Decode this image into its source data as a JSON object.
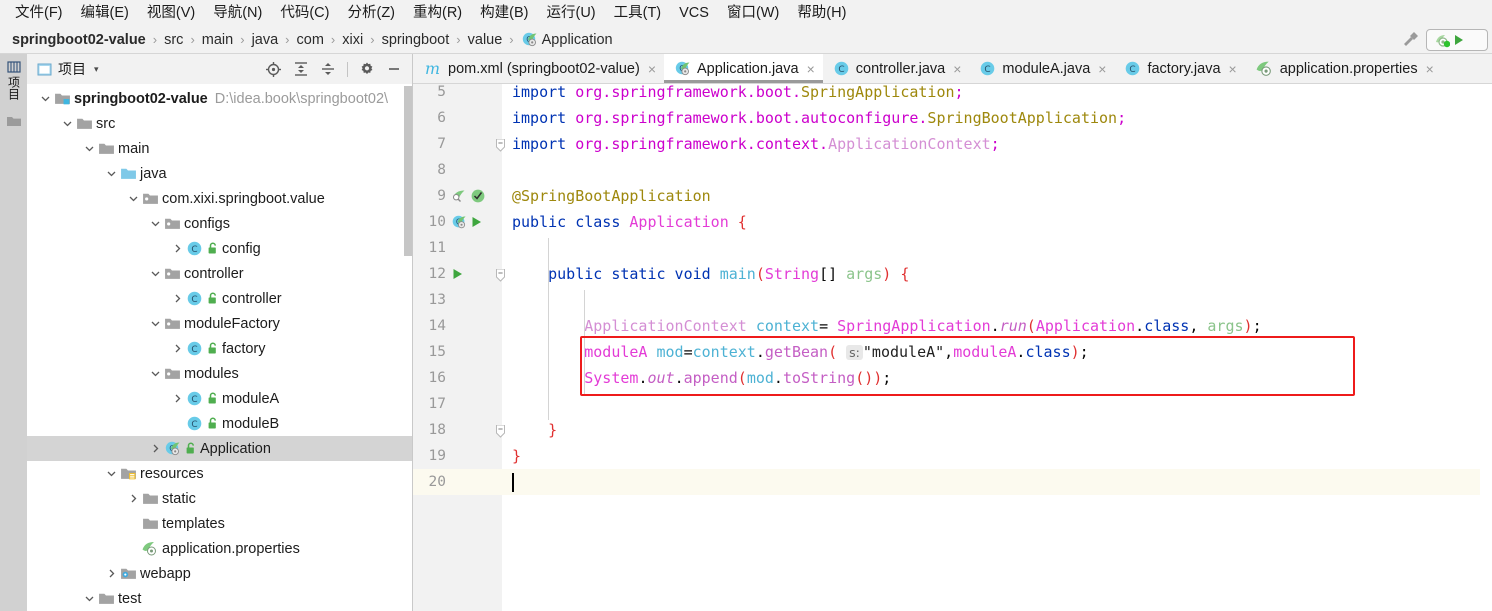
{
  "menubar": {
    "items": [
      {
        "label": "文件(F)"
      },
      {
        "label": "编辑(E)"
      },
      {
        "label": "视图(V)"
      },
      {
        "label": "导航(N)"
      },
      {
        "label": "代码(C)"
      },
      {
        "label": "分析(Z)"
      },
      {
        "label": "重构(R)"
      },
      {
        "label": "构建(B)"
      },
      {
        "label": "运行(U)"
      },
      {
        "label": "工具(T)"
      },
      {
        "label": "VCS"
      },
      {
        "label": "窗口(W)"
      },
      {
        "label": "帮助(H)"
      }
    ]
  },
  "breadcrumb": {
    "items": [
      {
        "label": "springboot02-value",
        "icon": "none"
      },
      {
        "label": "src",
        "icon": "none"
      },
      {
        "label": "main",
        "icon": "none"
      },
      {
        "label": "java",
        "icon": "none"
      },
      {
        "label": "com",
        "icon": "none"
      },
      {
        "label": "xixi",
        "icon": "none"
      },
      {
        "label": "springboot",
        "icon": "none"
      },
      {
        "label": "value",
        "icon": "none"
      },
      {
        "label": "Application",
        "icon": "spring-class-icon"
      }
    ],
    "separator": "›",
    "build_icon": "hammer-icon",
    "run_config_icon": "spring-run-config-icon"
  },
  "toolstrip": {
    "project_label": "项目",
    "folder_icon": "folder-icon"
  },
  "project_panel": {
    "title": "项目",
    "caret": "▾",
    "tools": [
      {
        "name": "locate-icon",
        "glyph": "target"
      },
      {
        "name": "expand-all-icon",
        "glyph": "expand"
      },
      {
        "name": "collapse-all-icon",
        "glyph": "collapse"
      },
      {
        "name": "settings-icon",
        "glyph": "gear"
      },
      {
        "name": "hide-icon",
        "glyph": "minus"
      }
    ],
    "tree": [
      {
        "label": "springboot02-value",
        "sub": "D:\\idea.book\\springboot02\\",
        "depth": 0,
        "twisty": "down",
        "icon": "module-folder-icon",
        "bold": true,
        "selected": false,
        "badge": ""
      },
      {
        "label": "src",
        "depth": 1,
        "twisty": "down",
        "icon": "folder-icon",
        "bold": false,
        "selected": false,
        "badge": ""
      },
      {
        "label": "main",
        "depth": 2,
        "twisty": "down",
        "icon": "folder-icon",
        "bold": false,
        "selected": false,
        "badge": ""
      },
      {
        "label": "java",
        "depth": 3,
        "twisty": "down",
        "icon": "source-folder-icon",
        "bold": false,
        "selected": false,
        "badge": ""
      },
      {
        "label": "com.xixi.springboot.value",
        "depth": 4,
        "twisty": "down",
        "icon": "package-icon",
        "bold": false,
        "selected": false,
        "badge": ""
      },
      {
        "label": "configs",
        "depth": 5,
        "twisty": "down",
        "icon": "package-icon",
        "bold": false,
        "selected": false,
        "badge": ""
      },
      {
        "label": "config",
        "depth": 6,
        "twisty": "right",
        "icon": "java-class-icon",
        "bold": false,
        "selected": false,
        "badge": "green-lock-icon"
      },
      {
        "label": "controller",
        "depth": 5,
        "twisty": "down",
        "icon": "package-icon",
        "bold": false,
        "selected": false,
        "badge": ""
      },
      {
        "label": "controller",
        "depth": 6,
        "twisty": "right",
        "icon": "java-class-icon",
        "bold": false,
        "selected": false,
        "badge": "green-lock-icon"
      },
      {
        "label": "moduleFactory",
        "depth": 5,
        "twisty": "down",
        "icon": "package-icon",
        "bold": false,
        "selected": false,
        "badge": ""
      },
      {
        "label": "factory",
        "depth": 6,
        "twisty": "right",
        "icon": "java-class-icon",
        "bold": false,
        "selected": false,
        "badge": "green-lock-icon"
      },
      {
        "label": "modules",
        "depth": 5,
        "twisty": "down",
        "icon": "package-icon",
        "bold": false,
        "selected": false,
        "badge": ""
      },
      {
        "label": "moduleA",
        "depth": 6,
        "twisty": "right",
        "icon": "java-class-icon",
        "bold": false,
        "selected": false,
        "badge": "green-lock-icon"
      },
      {
        "label": "moduleB",
        "depth": 6,
        "twisty": "none",
        "icon": "java-class-icon",
        "bold": false,
        "selected": false,
        "badge": "green-lock-icon"
      },
      {
        "label": "Application",
        "depth": 5,
        "twisty": "right",
        "icon": "spring-class-icon",
        "bold": false,
        "selected": true,
        "badge": "green-lock-icon"
      },
      {
        "label": "resources",
        "depth": 3,
        "twisty": "down",
        "icon": "resource-folder-icon",
        "bold": false,
        "selected": false,
        "badge": ""
      },
      {
        "label": "static",
        "depth": 4,
        "twisty": "right",
        "icon": "folder-icon",
        "bold": false,
        "selected": false,
        "badge": ""
      },
      {
        "label": "templates",
        "depth": 4,
        "twisty": "none",
        "icon": "folder-icon",
        "bold": false,
        "selected": false,
        "badge": ""
      },
      {
        "label": "application.properties",
        "depth": 4,
        "twisty": "none",
        "icon": "spring-properties-icon",
        "bold": false,
        "selected": false,
        "badge": ""
      },
      {
        "label": "webapp",
        "depth": 3,
        "twisty": "right",
        "icon": "webapp-folder-icon",
        "bold": false,
        "selected": false,
        "badge": ""
      },
      {
        "label": "test",
        "depth": 2,
        "twisty": "down",
        "icon": "folder-icon",
        "bold": false,
        "selected": false,
        "badge": ""
      }
    ]
  },
  "tabs": [
    {
      "label": "pom.xml (springboot02-value)",
      "icon": "maven-icon",
      "active": false,
      "close": "×"
    },
    {
      "label": "Application.java",
      "icon": "spring-class-icon",
      "active": true,
      "close": "×"
    },
    {
      "label": "controller.java",
      "icon": "java-class-icon",
      "active": false,
      "close": "×"
    },
    {
      "label": "moduleA.java",
      "icon": "java-class-icon",
      "active": false,
      "close": "×"
    },
    {
      "label": "factory.java",
      "icon": "java-class-icon",
      "active": false,
      "close": "×"
    },
    {
      "label": "application.properties",
      "icon": "spring-properties-icon",
      "active": false,
      "close": "×"
    }
  ],
  "editor": {
    "first_visible_line": 5,
    "caret_line": 20,
    "lines": [
      {
        "num": 5,
        "text": "import org.springframework.boot.SpringApplication;"
      },
      {
        "num": 6,
        "text": "import org.springframework.boot.autoconfigure.SpringBootApplication;"
      },
      {
        "num": 7,
        "text": "import org.springframework.context.ApplicationContext;"
      },
      {
        "num": 8,
        "text": ""
      },
      {
        "num": 9,
        "text": "@SpringBootApplication"
      },
      {
        "num": 10,
        "text": "public class Application {"
      },
      {
        "num": 11,
        "text": ""
      },
      {
        "num": 12,
        "text": "    public static void main(String[] args) {"
      },
      {
        "num": 13,
        "text": ""
      },
      {
        "num": 14,
        "text": "        ApplicationContext context= SpringApplication.run(Application.class, args);"
      },
      {
        "num": 15,
        "text": "        moduleA mod=context.getBean( s: \"moduleA\",moduleA.class);"
      },
      {
        "num": 16,
        "text": "        System.out.append(mod.toString());"
      },
      {
        "num": 17,
        "text": ""
      },
      {
        "num": 18,
        "text": "    }"
      },
      {
        "num": 19,
        "text": "}"
      },
      {
        "num": 20,
        "text": ""
      }
    ],
    "inlay_hint": "s:",
    "gutter_icons": [
      {
        "line": 9,
        "icons": [
          "spring-bean-icon",
          "spring-config-icon"
        ]
      },
      {
        "line": 10,
        "icons": [
          "spring-class-icon",
          "run-icon"
        ]
      },
      {
        "line": 12,
        "icons": [
          "run-icon"
        ]
      }
    ],
    "annotation": {
      "color": "#ee1b1b",
      "from_line": 15,
      "to_line": 16
    }
  },
  "colors": {
    "annotation_red": "#ee1b1b",
    "selection_gray": "#d4d4d4",
    "caret_line": "#fcfaef",
    "gutter_bg": "#f2f2f2",
    "chrome_bg": "#f2f2f2"
  }
}
